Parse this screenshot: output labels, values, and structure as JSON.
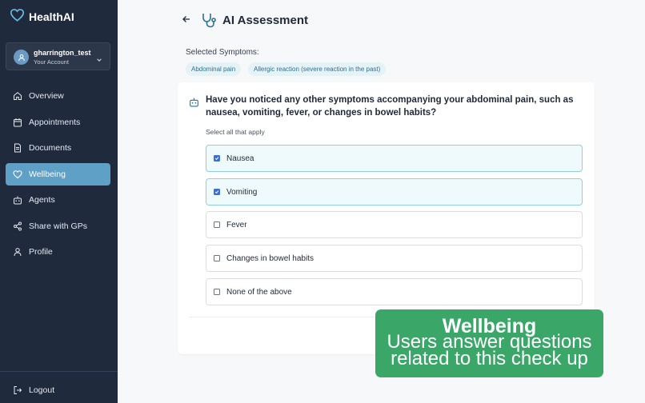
{
  "app": {
    "name": "HealthAI"
  },
  "account": {
    "username": "gharrington_test",
    "subtitle": "Your Account"
  },
  "sidebar": {
    "items": [
      {
        "label": "Overview",
        "icon": "home-icon",
        "active": false
      },
      {
        "label": "Appointments",
        "icon": "calendar-icon",
        "active": false
      },
      {
        "label": "Documents",
        "icon": "document-icon",
        "active": false
      },
      {
        "label": "Wellbeing",
        "icon": "heart-icon",
        "active": true
      },
      {
        "label": "Agents",
        "icon": "robot-icon",
        "active": false
      },
      {
        "label": "Share with GPs",
        "icon": "share-icon",
        "active": false
      },
      {
        "label": "Profile",
        "icon": "user-icon",
        "active": false
      }
    ],
    "logout_label": "Logout"
  },
  "header": {
    "title": "AI Assessment"
  },
  "symptoms": {
    "label": "Selected Symptoms:",
    "chips": [
      "Abdominal pain",
      "Allergic reaction (severe reaction in the past)"
    ]
  },
  "question": {
    "text": "Have you noticed any other symptoms accompanying your abdominal pain, such as nausea, vomiting, fever, or changes in bowel habits?",
    "hint": "Select all that apply",
    "options": [
      {
        "label": "Nausea",
        "checked": true
      },
      {
        "label": "Vomiting",
        "checked": true
      },
      {
        "label": "Fever",
        "checked": false
      },
      {
        "label": "Changes in bowel habits",
        "checked": false
      },
      {
        "label": "None of the above",
        "checked": false
      }
    ]
  },
  "banner": {
    "title": "Wellbeing",
    "text": "Users answer questions related to this check up"
  },
  "colors": {
    "sidebar_bg": "#1f2a3c",
    "active_nav": "#5fa0c7",
    "chip_bg": "#e6f3f6",
    "banner_bg": "#3aa769",
    "checkbox_on": "#3b6fd6"
  }
}
